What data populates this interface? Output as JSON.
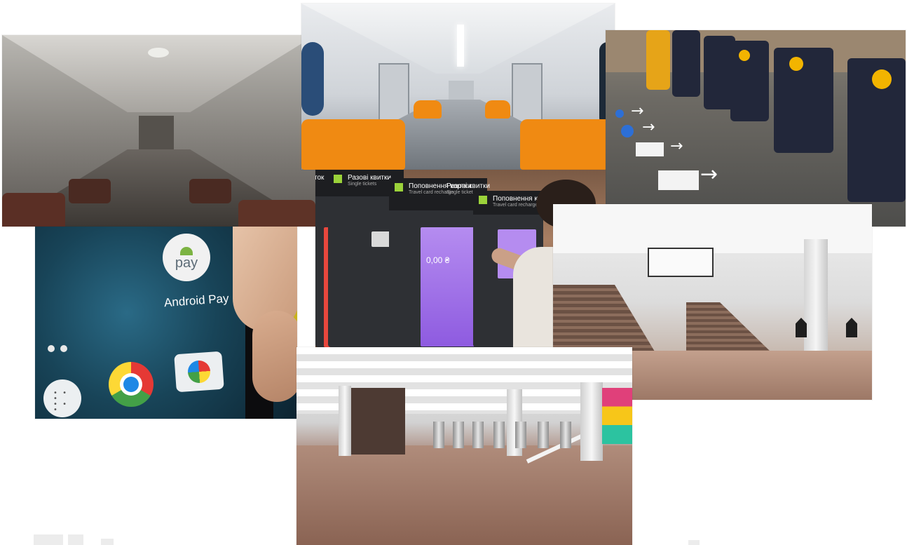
{
  "collage": {
    "photos": [
      {
        "subject": "old metro car interior"
      },
      {
        "subject": "modern metro car interior with orange seats"
      },
      {
        "subject": "metro turnstiles with QR readers"
      },
      {
        "subject": "Android Pay app on smartphone"
      },
      {
        "subject": "ticket vending machines"
      },
      {
        "subject": "metro station stairs"
      },
      {
        "subject": "metro station concourse with turnstiles"
      }
    ]
  },
  "android_pay": {
    "icon_text": "pay",
    "app_label": "Android Pay"
  },
  "kiosks": {
    "left_title": "Разові квитки",
    "left_subtitle": "Single tickets",
    "left_edge_title": "ток",
    "middle_title": "Поповнення картки",
    "middle_subtitle": "Travel card recharge",
    "middle_title_2": "Разові квитки",
    "middle_subtitle_2": "Single tickets",
    "right_title": "Поповнення карт",
    "right_subtitle": "Travel card recharge",
    "screen_amount": "0,00 ₴"
  },
  "colors": {
    "seat_orange": "#f08a12",
    "turnstile_navy": "#22273a",
    "reader_yellow": "#f2b400",
    "kiosk_screen_purple": "#b58cf0",
    "kiosk_logo_green": "#9bd23a"
  }
}
